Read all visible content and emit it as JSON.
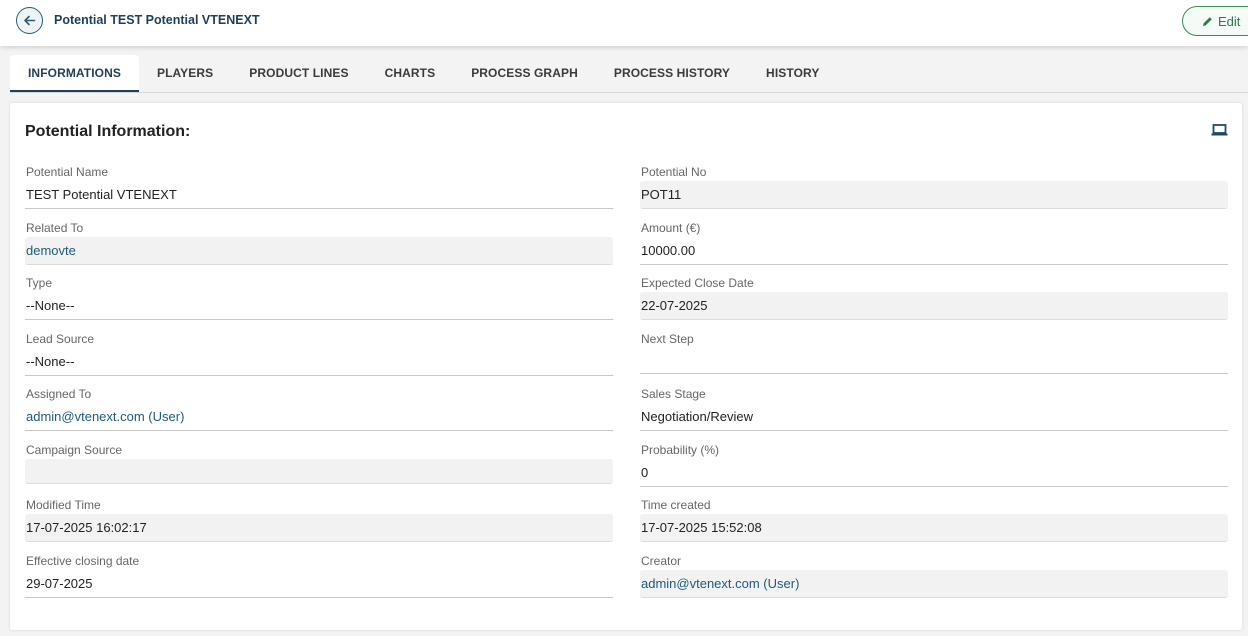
{
  "header": {
    "title": "Potential TEST Potential VTENEXT",
    "edit_label": "Edit"
  },
  "tabs": [
    {
      "label": "INFORMATIONS",
      "active": true
    },
    {
      "label": "PLAYERS"
    },
    {
      "label": "PRODUCT LINES"
    },
    {
      "label": "CHARTS"
    },
    {
      "label": "PROCESS GRAPH"
    },
    {
      "label": "PROCESS HISTORY"
    },
    {
      "label": "HISTORY"
    }
  ],
  "section": {
    "title": "Potential Information:"
  },
  "fields": {
    "potential_name": {
      "label": "Potential Name",
      "value": "TEST Potential VTENEXT"
    },
    "potential_no": {
      "label": "Potential No",
      "value": "POT11"
    },
    "related_to": {
      "label": "Related To",
      "value": "demovte"
    },
    "amount": {
      "label": "Amount (€)",
      "value": "10000.00"
    },
    "type": {
      "label": "Type",
      "value": "--None--"
    },
    "expected_close_date": {
      "label": "Expected Close Date",
      "value": "22-07-2025"
    },
    "lead_source": {
      "label": "Lead Source",
      "value": "--None--"
    },
    "next_step": {
      "label": "Next Step",
      "value": ""
    },
    "assigned_to": {
      "label": "Assigned To",
      "value": "admin@vtenext.com (User)"
    },
    "sales_stage": {
      "label": "Sales Stage",
      "value": "Negotiation/Review"
    },
    "campaign_source": {
      "label": "Campaign Source",
      "value": ""
    },
    "probability": {
      "label": "Probability (%)",
      "value": "0"
    },
    "modified_time": {
      "label": "Modified Time",
      "value": "17-07-2025 16:02:17"
    },
    "time_created": {
      "label": "Time created",
      "value": "17-07-2025 15:52:08"
    },
    "effective_closing_date": {
      "label": "Effective closing date",
      "value": "29-07-2025"
    },
    "creator": {
      "label": "Creator",
      "value": "admin@vtenext.com (User)"
    }
  },
  "icons": {
    "back": "arrow-left-icon",
    "edit": "pencil-icon",
    "layout": "laptop-icon"
  },
  "colors": {
    "primary": "#1e3f57",
    "link": "#1e5b7a",
    "edit_green": "#2e7a46"
  }
}
